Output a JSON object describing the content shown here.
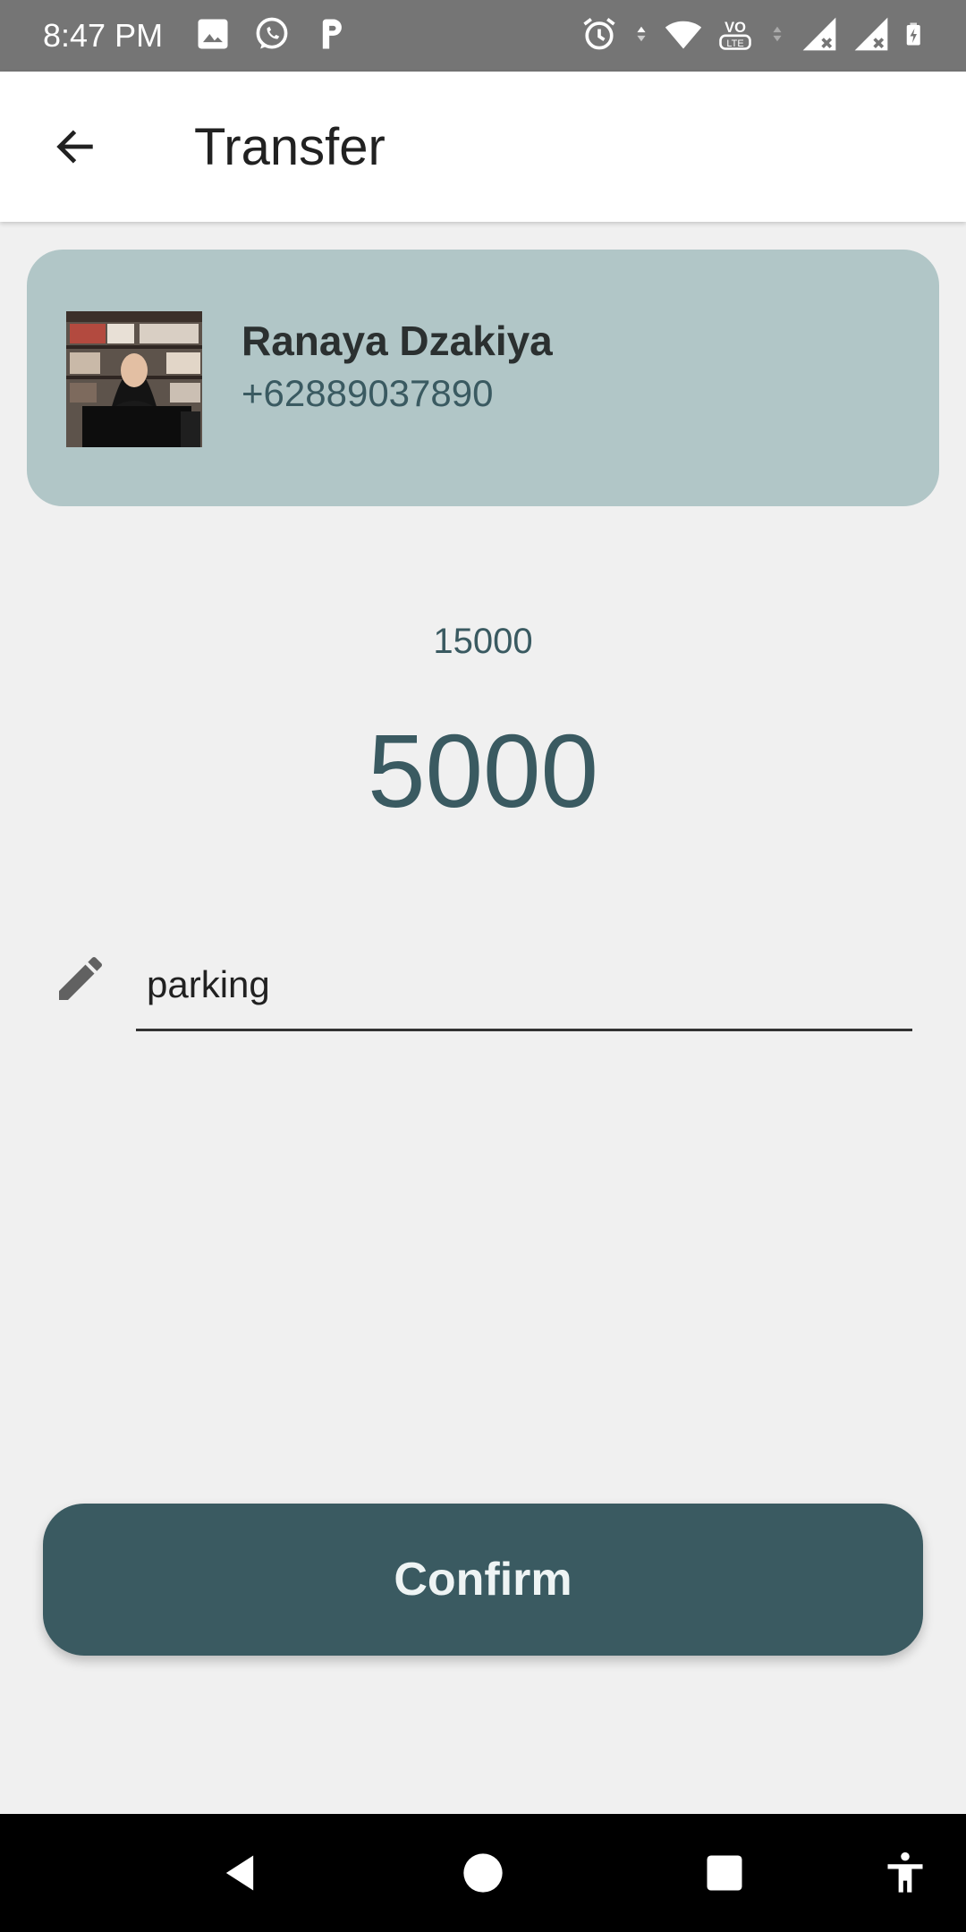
{
  "status_bar": {
    "time": "8:47 PM",
    "left_icons": [
      "gallery-icon",
      "whatsapp-icon",
      "parking-app-icon"
    ],
    "right_icons": [
      "alarm-icon",
      "data-arrows-icon",
      "wifi-icon",
      "volte-icon",
      "signal-icon",
      "signal-icon",
      "battery-icon"
    ]
  },
  "app_bar": {
    "title": "Transfer",
    "back_icon": "arrow-left-icon"
  },
  "recipient": {
    "name": "Ranaya Dzakiya",
    "phone": "+62889037890"
  },
  "transfer": {
    "balance": "15000",
    "amount": "5000"
  },
  "note": {
    "icon": "pencil-icon",
    "value": "parking"
  },
  "actions": {
    "confirm_label": "Confirm"
  },
  "nav_bar": {
    "icons": [
      "back-triangle-icon",
      "home-circle-icon",
      "recents-square-icon",
      "accessibility-icon"
    ]
  },
  "colors": {
    "status_bar": "#757575",
    "card": "#b1c6c7",
    "accent": "#3a5a61",
    "background": "#f0f0f0"
  }
}
